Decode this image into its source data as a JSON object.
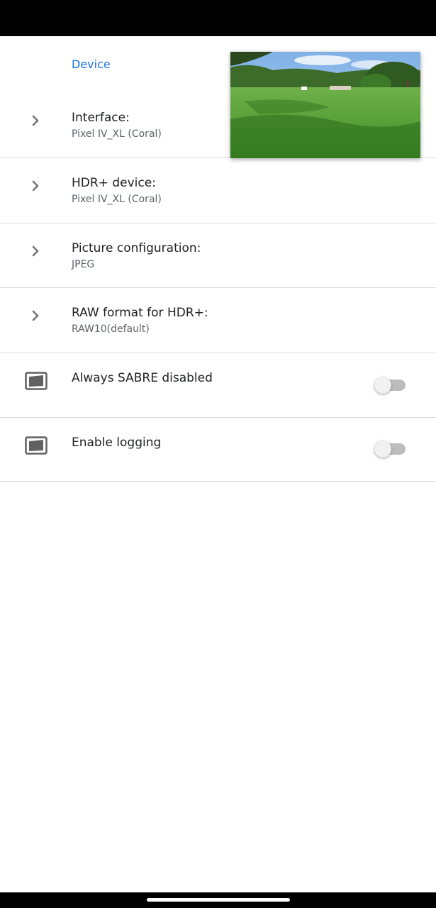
{
  "section": {
    "header": "Device"
  },
  "settings": [
    {
      "title": "Interface:",
      "summary": "Pixel IV_XL (Coral)",
      "icon": "chevron-right-icon"
    },
    {
      "title": "HDR+ device:",
      "summary": "Pixel IV_XL (Coral)",
      "icon": "chevron-right-icon"
    },
    {
      "title": "Picture configuration:",
      "summary": "JPEG",
      "icon": "chevron-right-icon"
    },
    {
      "title": "RAW format for HDR+:",
      "summary": "RAW10(default)",
      "icon": "chevron-right-icon"
    }
  ],
  "toggles": [
    {
      "title": "Always SABRE disabled",
      "enabled": false,
      "icon": "image-icon"
    },
    {
      "title": "Enable logging",
      "enabled": false,
      "icon": "image-icon"
    }
  ],
  "preview": {
    "icon": "camera-preview-thumbnail"
  },
  "colors": {
    "accent": "#1a73e8",
    "divider": "#dcdcdc",
    "summary": "#5f6368"
  }
}
